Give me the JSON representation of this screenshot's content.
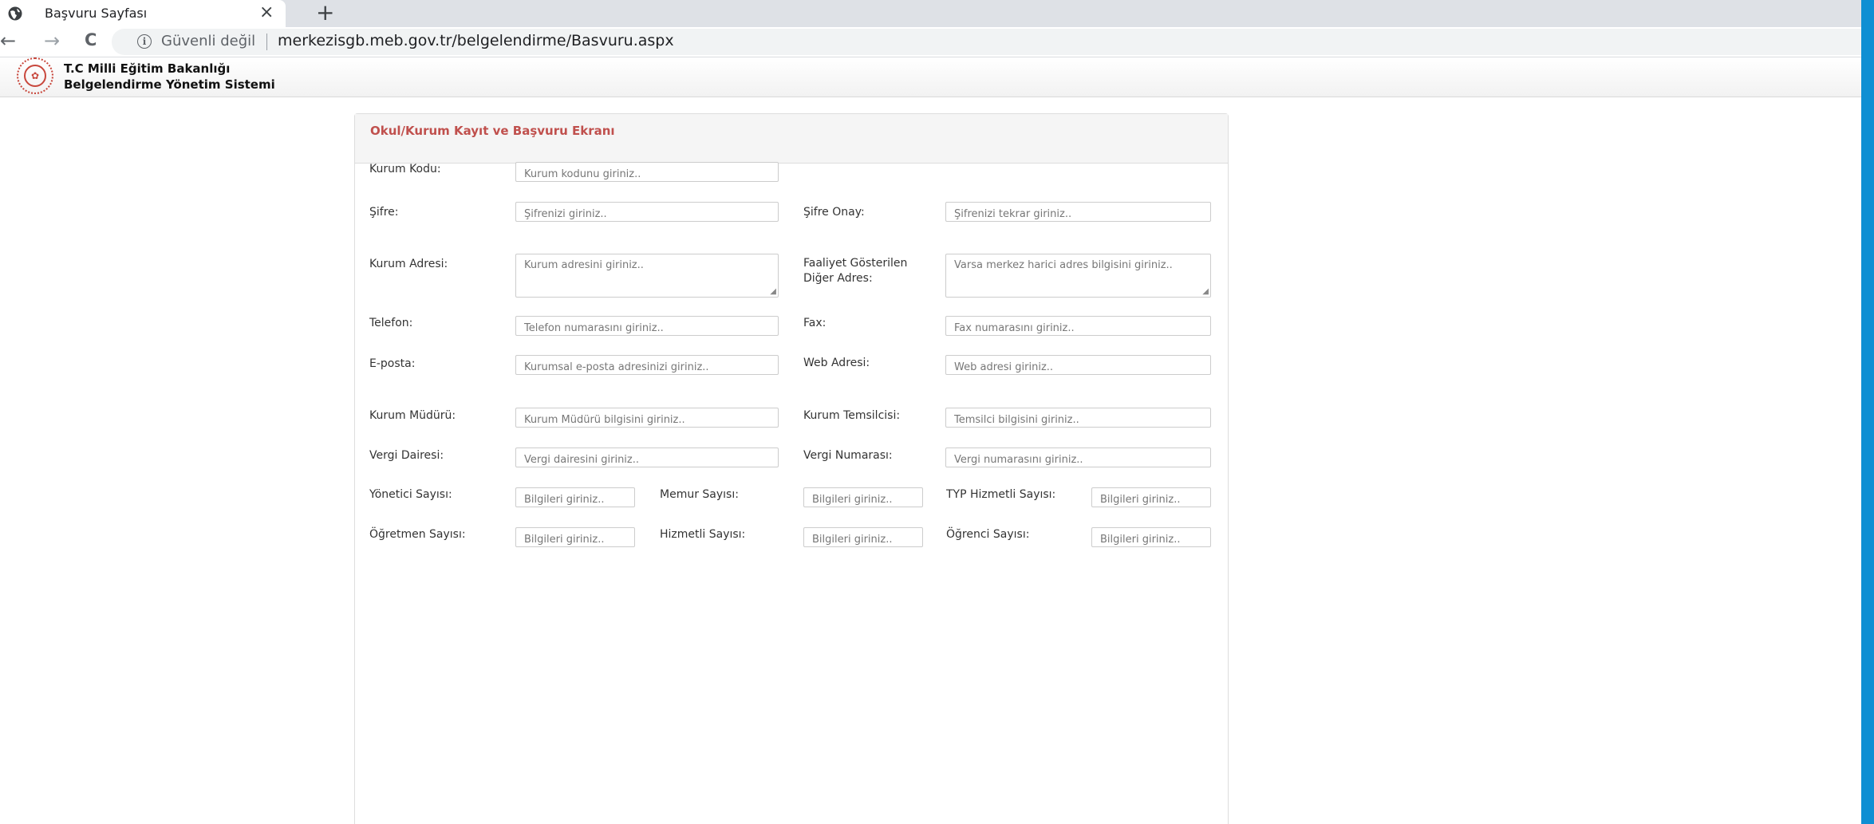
{
  "browser": {
    "tab_title": "Başvuru Sayfası",
    "tab_close": "×",
    "new_tab": "+",
    "back": "←",
    "forward": "→",
    "reload": "C",
    "security_text": "Güvenli değil",
    "url": "merkezisgb.meb.gov.tr/belgelendirme/Basvuru.aspx"
  },
  "site": {
    "title_line1": "T.C Milli Eğitim Bakanlığı",
    "title_line2": "Belgelendirme Yönetim Sistemi"
  },
  "form": {
    "title": "Okul/Kurum Kayıt ve Başvuru Ekranı",
    "fields": {
      "kurum_kodu": {
        "label": "Kurum Kodu:",
        "placeholder": "Kurum kodunu giriniz.."
      },
      "sifre": {
        "label": "Şifre:",
        "placeholder": "Şifrenizi giriniz.."
      },
      "sifre_onay": {
        "label": "Şifre Onay:",
        "placeholder": "Şifrenizi tekrar giriniz.."
      },
      "kurum_adresi": {
        "label": "Kurum Adresi:",
        "placeholder": "Kurum adresini giriniz.."
      },
      "diger_adres": {
        "label_line1": "Faaliyet Gösterilen",
        "label_line2": "Diğer Adres:",
        "placeholder": "Varsa merkez harici adres bilgisini giriniz.."
      },
      "telefon": {
        "label": "Telefon:",
        "placeholder": "Telefon numarasını giriniz.."
      },
      "fax": {
        "label": "Fax:",
        "placeholder": "Fax numarasını giriniz.."
      },
      "eposta": {
        "label": "E-posta:",
        "placeholder": "Kurumsal e-posta adresinizi giriniz.."
      },
      "web": {
        "label": "Web Adresi:",
        "placeholder": "Web adresi giriniz.."
      },
      "mudur": {
        "label": "Kurum Müdürü:",
        "placeholder": "Kurum Müdürü bilgisini giriniz.."
      },
      "temsilci": {
        "label": "Kurum Temsilcisi:",
        "placeholder": "Temsilci bilgisini giriniz.."
      },
      "vergi_dairesi": {
        "label": "Vergi Dairesi:",
        "placeholder": "Vergi dairesini giriniz.."
      },
      "vergi_no": {
        "label": "Vergi Numarası:",
        "placeholder": "Vergi numarasını giriniz.."
      },
      "yonetici": {
        "label": "Yönetici Sayısı:",
        "placeholder": "Bilgileri giriniz.."
      },
      "memur": {
        "label": "Memur Sayısı:",
        "placeholder": "Bilgileri giriniz.."
      },
      "typ": {
        "label": "TYP Hizmetli Sayısı:",
        "placeholder": "Bilgileri giriniz.."
      },
      "ogretmen": {
        "label": "Öğretmen Sayısı:",
        "placeholder": "Bilgileri giriniz.."
      },
      "hizmetli": {
        "label": "Hizmetli Sayısı:",
        "placeholder": "Bilgileri giriniz.."
      },
      "ogrenci": {
        "label": "Öğrenci Sayısı:",
        "placeholder": "Bilgileri giriniz.."
      }
    }
  }
}
